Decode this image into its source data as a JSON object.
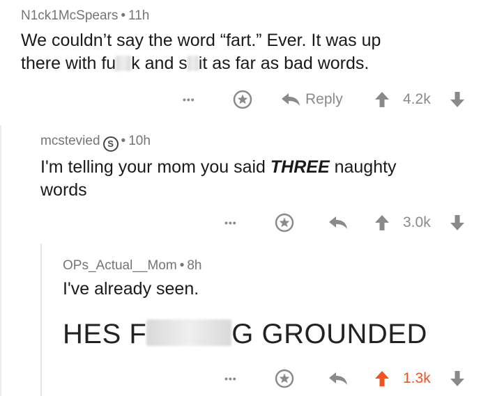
{
  "comments": [
    {
      "author": "N1ck1McSpears",
      "time": "11h",
      "line1": "We couldn’t say the word “fart.” Ever. It was up",
      "line2_a": "there with fu",
      "line2_b": "k and s",
      "line2_c": "it as far as bad words.",
      "reply_label": "Reply",
      "score": "4.2k"
    },
    {
      "author": "mcstevied",
      "badge": "S",
      "time": "10h",
      "line1_a": "I'm telling your mom you said ",
      "line1_b": "THREE",
      "line1_c": " naughty",
      "line2": "words",
      "score": "3.0k"
    },
    {
      "author": "OPs_Actual__Mom",
      "time": "8h",
      "line1": "I've already seen.",
      "big_a": "HES F",
      "big_b": "G GROUNDED",
      "score": "1.3k"
    }
  ],
  "more_label": "•••",
  "colors": {
    "upvoted": "#f4511e",
    "icon": "#8a8a8a"
  }
}
